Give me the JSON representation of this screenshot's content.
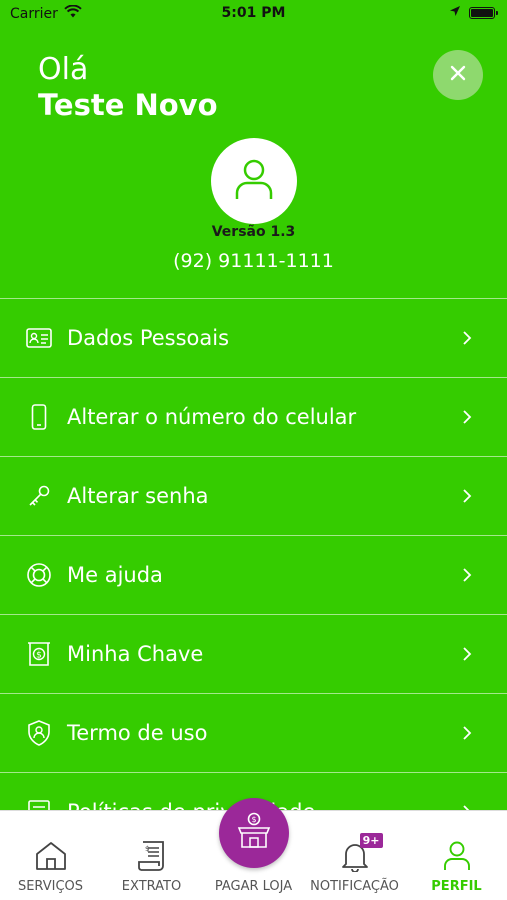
{
  "status_bar": {
    "carrier": "Carrier",
    "time": "5:01 PM"
  },
  "header": {
    "greeting": "Olá",
    "user_name": "Teste Novo",
    "version": "Versão 1.3",
    "phone": "(92) 91111-1111"
  },
  "menu": {
    "items": [
      {
        "label": "Dados Pessoais",
        "icon": "id-card-icon"
      },
      {
        "label": "Alterar o número do celular",
        "icon": "phone-icon"
      },
      {
        "label": "Alterar senha",
        "icon": "key-icon"
      },
      {
        "label": "Me ajuda",
        "icon": "lifebuoy-icon"
      },
      {
        "label": "Minha Chave",
        "icon": "money-slot-icon"
      },
      {
        "label": "Termo de uso",
        "icon": "shield-user-icon"
      },
      {
        "label": "Políticas de privacidade",
        "icon": "document-icon"
      }
    ]
  },
  "bottom_nav": {
    "items": [
      {
        "label": "SERVIÇOS",
        "icon": "home-icon"
      },
      {
        "label": "EXTRATO",
        "icon": "receipt-icon"
      },
      {
        "label": "PAGAR LOJA",
        "icon": "store-icon"
      },
      {
        "label": "NOTIFICAÇÃO",
        "icon": "bell-icon",
        "badge": "9+"
      },
      {
        "label": "PERFIL",
        "icon": "user-icon",
        "active": true
      }
    ]
  },
  "colors": {
    "primary_green": "#35cc00",
    "accent_purple": "#9b2899",
    "close_button_bg": "#8ed96e"
  }
}
